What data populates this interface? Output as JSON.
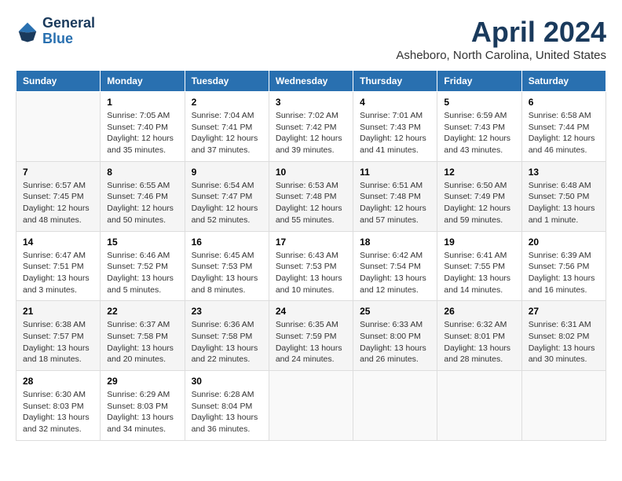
{
  "header": {
    "logo_line1": "General",
    "logo_line2": "Blue",
    "month_title": "April 2024",
    "location": "Asheboro, North Carolina, United States"
  },
  "weekdays": [
    "Sunday",
    "Monday",
    "Tuesday",
    "Wednesday",
    "Thursday",
    "Friday",
    "Saturday"
  ],
  "weeks": [
    [
      {
        "day": "",
        "info": ""
      },
      {
        "day": "1",
        "info": "Sunrise: 7:05 AM\nSunset: 7:40 PM\nDaylight: 12 hours\nand 35 minutes."
      },
      {
        "day": "2",
        "info": "Sunrise: 7:04 AM\nSunset: 7:41 PM\nDaylight: 12 hours\nand 37 minutes."
      },
      {
        "day": "3",
        "info": "Sunrise: 7:02 AM\nSunset: 7:42 PM\nDaylight: 12 hours\nand 39 minutes."
      },
      {
        "day": "4",
        "info": "Sunrise: 7:01 AM\nSunset: 7:43 PM\nDaylight: 12 hours\nand 41 minutes."
      },
      {
        "day": "5",
        "info": "Sunrise: 6:59 AM\nSunset: 7:43 PM\nDaylight: 12 hours\nand 43 minutes."
      },
      {
        "day": "6",
        "info": "Sunrise: 6:58 AM\nSunset: 7:44 PM\nDaylight: 12 hours\nand 46 minutes."
      }
    ],
    [
      {
        "day": "7",
        "info": "Sunrise: 6:57 AM\nSunset: 7:45 PM\nDaylight: 12 hours\nand 48 minutes."
      },
      {
        "day": "8",
        "info": "Sunrise: 6:55 AM\nSunset: 7:46 PM\nDaylight: 12 hours\nand 50 minutes."
      },
      {
        "day": "9",
        "info": "Sunrise: 6:54 AM\nSunset: 7:47 PM\nDaylight: 12 hours\nand 52 minutes."
      },
      {
        "day": "10",
        "info": "Sunrise: 6:53 AM\nSunset: 7:48 PM\nDaylight: 12 hours\nand 55 minutes."
      },
      {
        "day": "11",
        "info": "Sunrise: 6:51 AM\nSunset: 7:48 PM\nDaylight: 12 hours\nand 57 minutes."
      },
      {
        "day": "12",
        "info": "Sunrise: 6:50 AM\nSunset: 7:49 PM\nDaylight: 12 hours\nand 59 minutes."
      },
      {
        "day": "13",
        "info": "Sunrise: 6:48 AM\nSunset: 7:50 PM\nDaylight: 13 hours\nand 1 minute."
      }
    ],
    [
      {
        "day": "14",
        "info": "Sunrise: 6:47 AM\nSunset: 7:51 PM\nDaylight: 13 hours\nand 3 minutes."
      },
      {
        "day": "15",
        "info": "Sunrise: 6:46 AM\nSunset: 7:52 PM\nDaylight: 13 hours\nand 5 minutes."
      },
      {
        "day": "16",
        "info": "Sunrise: 6:45 AM\nSunset: 7:53 PM\nDaylight: 13 hours\nand 8 minutes."
      },
      {
        "day": "17",
        "info": "Sunrise: 6:43 AM\nSunset: 7:53 PM\nDaylight: 13 hours\nand 10 minutes."
      },
      {
        "day": "18",
        "info": "Sunrise: 6:42 AM\nSunset: 7:54 PM\nDaylight: 13 hours\nand 12 minutes."
      },
      {
        "day": "19",
        "info": "Sunrise: 6:41 AM\nSunset: 7:55 PM\nDaylight: 13 hours\nand 14 minutes."
      },
      {
        "day": "20",
        "info": "Sunrise: 6:39 AM\nSunset: 7:56 PM\nDaylight: 13 hours\nand 16 minutes."
      }
    ],
    [
      {
        "day": "21",
        "info": "Sunrise: 6:38 AM\nSunset: 7:57 PM\nDaylight: 13 hours\nand 18 minutes."
      },
      {
        "day": "22",
        "info": "Sunrise: 6:37 AM\nSunset: 7:58 PM\nDaylight: 13 hours\nand 20 minutes."
      },
      {
        "day": "23",
        "info": "Sunrise: 6:36 AM\nSunset: 7:58 PM\nDaylight: 13 hours\nand 22 minutes."
      },
      {
        "day": "24",
        "info": "Sunrise: 6:35 AM\nSunset: 7:59 PM\nDaylight: 13 hours\nand 24 minutes."
      },
      {
        "day": "25",
        "info": "Sunrise: 6:33 AM\nSunset: 8:00 PM\nDaylight: 13 hours\nand 26 minutes."
      },
      {
        "day": "26",
        "info": "Sunrise: 6:32 AM\nSunset: 8:01 PM\nDaylight: 13 hours\nand 28 minutes."
      },
      {
        "day": "27",
        "info": "Sunrise: 6:31 AM\nSunset: 8:02 PM\nDaylight: 13 hours\nand 30 minutes."
      }
    ],
    [
      {
        "day": "28",
        "info": "Sunrise: 6:30 AM\nSunset: 8:03 PM\nDaylight: 13 hours\nand 32 minutes."
      },
      {
        "day": "29",
        "info": "Sunrise: 6:29 AM\nSunset: 8:03 PM\nDaylight: 13 hours\nand 34 minutes."
      },
      {
        "day": "30",
        "info": "Sunrise: 6:28 AM\nSunset: 8:04 PM\nDaylight: 13 hours\nand 36 minutes."
      },
      {
        "day": "",
        "info": ""
      },
      {
        "day": "",
        "info": ""
      },
      {
        "day": "",
        "info": ""
      },
      {
        "day": "",
        "info": ""
      }
    ]
  ]
}
